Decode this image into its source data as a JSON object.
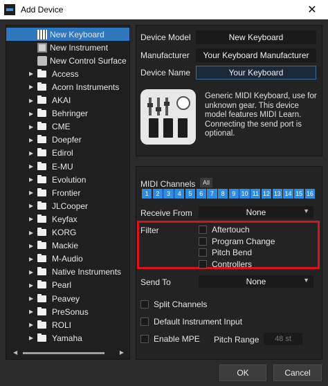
{
  "window": {
    "title": "Add Device",
    "close_glyph": "✕"
  },
  "tree": {
    "devices": [
      {
        "label": "New Keyboard",
        "icon": "keyboard-icon",
        "selected": true
      },
      {
        "label": "New Instrument",
        "icon": "instrument-icon",
        "selected": false
      },
      {
        "label": "New Control Surface",
        "icon": "control-surface-icon",
        "selected": false
      }
    ],
    "folders": [
      "Access",
      "Acorn Instruments",
      "AKAI",
      "Behringer",
      "CME",
      "Doepfer",
      "Edirol",
      "E-MU",
      "Evolution",
      "Frontier",
      "JLCooper",
      "Keyfax",
      "KORG",
      "Mackie",
      "M-Audio",
      "Native Instruments",
      "Pearl",
      "Peavey",
      "PreSonus",
      "ROLI",
      "Yamaha"
    ],
    "arrow_glyph": "▶",
    "scroll_left": "◀",
    "scroll_right": "▶"
  },
  "device": {
    "model_label": "Device Model",
    "model_value": "New Keyboard",
    "manufacturer_label": "Manufacturer",
    "manufacturer_value": "Your Keyboard Manufacturer",
    "name_label": "Device Name",
    "name_value": "Your Keyboard",
    "description": "Generic MIDI Keyboard, use for unknown gear. This device model features MIDI Learn. Connecting the send port is optional."
  },
  "midi": {
    "channels_label": "MIDI Channels",
    "all_label": "All",
    "channels": [
      "1",
      "2",
      "3",
      "4",
      "5",
      "6",
      "7",
      "8",
      "9",
      "10",
      "11",
      "12",
      "13",
      "14",
      "15",
      "16"
    ],
    "receive_label": "Receive From",
    "receive_value": "None",
    "filter_label": "Filter",
    "filters": [
      "Aftertouch",
      "Program Change",
      "Pitch Bend",
      "Controllers"
    ],
    "send_label": "Send To",
    "send_value": "None",
    "split_channels_label": "Split Channels",
    "default_input_label": "Default Instrument Input",
    "enable_mpe_label": "Enable MPE",
    "pitch_range_label": "Pitch Range",
    "pitch_range_value": "48 st",
    "caret_glyph": "▼"
  },
  "buttons": {
    "ok": "OK",
    "cancel": "Cancel"
  },
  "colors": {
    "accent": "#2f77bf",
    "channel": "#2f8be0",
    "highlight": "#d9121f"
  }
}
